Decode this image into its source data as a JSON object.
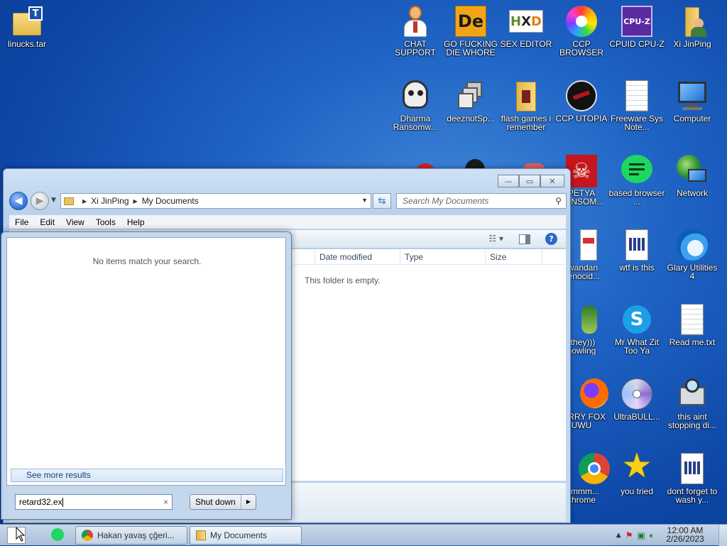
{
  "desktop": {
    "icons": [
      {
        "id": "linucks",
        "label": "linucks.tar",
        "icon": "folder-archive-icon"
      },
      {
        "id": "chat",
        "label": "CHAT SUPPORT",
        "icon": "support-person-icon"
      },
      {
        "id": "die",
        "label": "GO FUCKING DIE WHORE",
        "icon": "de-logo-icon"
      },
      {
        "id": "hxd",
        "label": "SEX EDITOR",
        "icon": "hex-editor-icon"
      },
      {
        "id": "ccp",
        "label": "CCP BROWSER",
        "icon": "colorful-browser-icon"
      },
      {
        "id": "cpuz",
        "label": "CPUID CPU-Z",
        "icon": "cpu-z-icon"
      },
      {
        "id": "xijin",
        "label": "Xi JinPing",
        "icon": "user-folder-icon"
      },
      {
        "id": "dharma",
        "label": "Dharma Ransomw...",
        "icon": "skull-headset-icon"
      },
      {
        "id": "deeznut",
        "label": "deeznutSp...",
        "icon": "stacked-windows-icon"
      },
      {
        "id": "flash",
        "label": "flash games i remember",
        "icon": "folder-icon"
      },
      {
        "id": "utopia",
        "label": "CCP UTOPIA",
        "icon": "dark-circle-icon"
      },
      {
        "id": "freeware",
        "label": "Freeware Sys Note...",
        "icon": "text-document-icon"
      },
      {
        "id": "computer",
        "label": "Computer",
        "icon": "computer-icon"
      },
      {
        "id": "petya",
        "label": "PETYA RANSOM...",
        "icon": "skull-crossbones-icon"
      },
      {
        "id": "based",
        "label": "based browser ...",
        "icon": "green-chat-icon"
      },
      {
        "id": "network",
        "label": "Network",
        "icon": "network-globe-icon"
      },
      {
        "id": "rwandan",
        "label": "rwandan genocid...",
        "icon": "meme-face-icon"
      },
      {
        "id": "wtf",
        "label": "wtf is this",
        "icon": "calendar-document-icon"
      },
      {
        "id": "glary",
        "label": "Glary Utilities 4",
        "icon": "glary-swirl-icon"
      },
      {
        "id": "they",
        "label": "(they))) howling",
        "icon": "creature-icon"
      },
      {
        "id": "skype",
        "label": "Mr What Zit Too Ya",
        "icon": "skype-icon"
      },
      {
        "id": "readme",
        "label": "Read me.txt",
        "icon": "text-document-icon"
      },
      {
        "id": "firefox",
        "label": "FERRY FOX UWU",
        "icon": "firefox-icon"
      },
      {
        "id": "ultrabull",
        "label": "UltraBULL...",
        "icon": "disc-icon"
      },
      {
        "id": "aint",
        "label": "this aint stopping di...",
        "icon": "magnifier-computer-icon"
      },
      {
        "id": "chrome",
        "label": "mmmm... chrome",
        "icon": "chrome-icon"
      },
      {
        "id": "tried",
        "label": "you tried",
        "icon": "star-icon"
      },
      {
        "id": "wash",
        "label": "dont forget to wash y...",
        "icon": "calendar-document-icon"
      }
    ]
  },
  "explorer": {
    "window_buttons": {
      "minimize": "—",
      "maximize": "▭",
      "close": "✕"
    },
    "back": "◀",
    "forward": "▶",
    "breadcrumb": [
      "Xi JinPing",
      "My Documents"
    ],
    "search_placeholder": "Search My Documents",
    "menu": [
      "File",
      "Edit",
      "View",
      "Tools",
      "Help"
    ],
    "columns": [
      "Date modified",
      "Type",
      "Size"
    ],
    "empty_message": "This folder is empty."
  },
  "startmenu": {
    "no_items": "No items match your search.",
    "see_more": "See more results",
    "search_value": "retard32.ex",
    "shutdown_label": "Shut down"
  },
  "taskbar": {
    "items": [
      {
        "label": "Hakan yavaş çğeri..."
      },
      {
        "label": "My Documents"
      }
    ],
    "clock_time": "12:00 AM",
    "clock_date": "2/26/2023"
  },
  "colors": {
    "accent": "#1e63c4",
    "taskbar": "#b8cbe0",
    "window_glass": "#c5d9ef"
  }
}
